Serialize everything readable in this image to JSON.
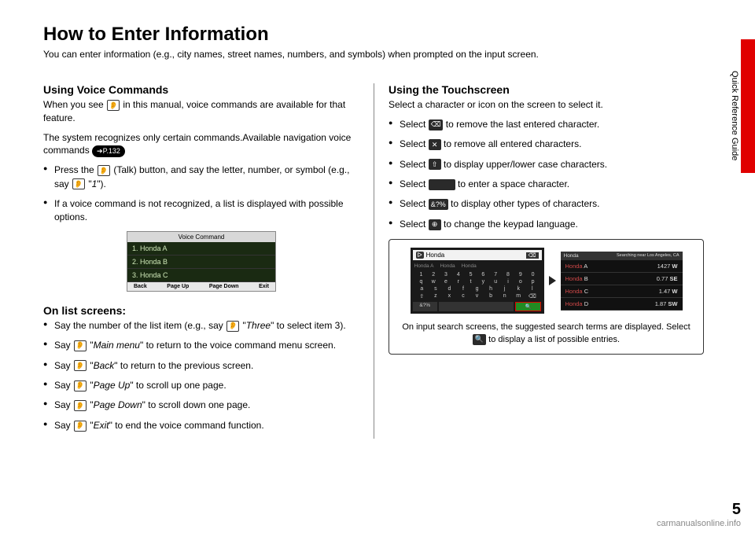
{
  "page": {
    "number": "5",
    "side_label": "Quick Reference Guide",
    "watermark": "carmanualsonline.info"
  },
  "header": {
    "title": "How to Enter Information",
    "intro": "You can enter information (e.g., city names, street names, numbers, and symbols) when prompted on the input screen."
  },
  "voice": {
    "heading": "Using Voice Commands",
    "p1a": "When you see ",
    "p1b": " in this manual, voice commands are available for that feature.",
    "p2": "The system recognizes only certain commands.Available navigation voice commands ",
    "pageref": "P.132",
    "b1a": "Press the ",
    "b1b": " (Talk) button, and say the letter, number, or symbol (e.g., say ",
    "b1c": " \"",
    "b1_cmd": "1",
    "b1d": "\").",
    "b2": "If a voice command is not recognized, a list is displayed with possible options.",
    "screenshot": {
      "title": "Voice Command",
      "rows": [
        "1. Honda A",
        "2. Honda B",
        "3. Honda C"
      ],
      "foot": [
        "Back",
        "Page Up",
        "Page Down",
        "Exit"
      ]
    }
  },
  "list": {
    "heading": "On list screens:",
    "b1a": "Say the number of the list item (e.g., say ",
    "b1b": " \"",
    "b1_cmd": "Three",
    "b1c": "\" to select item 3).",
    "b2a": "Say ",
    "b2_cmd": "Main menu",
    "b2b": "\" to return to the voice command menu screen.",
    "b3a": "Say ",
    "b3_cmd": "Back",
    "b3b": "\" to return to the previous screen.",
    "b4a": "Say ",
    "b4_cmd": "Page Up",
    "b4b": "\" to scroll up one page.",
    "b5a": "Say ",
    "b5_cmd": "Page Down",
    "b5b": "\" to scroll down one page.",
    "b6a": "Say ",
    "b6_cmd": "Exit",
    "b6b": "\" to end the voice command function."
  },
  "touch": {
    "heading": "Using the Touchscreen",
    "p1": "Select a character or icon on the screen to select it.",
    "b1": " to remove the last entered character.",
    "b2": " to remove all entered characters.",
    "b3": " to display upper/lower case characters.",
    "b4": " to enter a space character.",
    "b5": " to display other types of characters.",
    "b6": " to change the keypad language.",
    "select": "Select ",
    "icons": {
      "del": "⌫",
      "clear": "✕",
      "shift": "⇧",
      "sym": "&?%",
      "globe": "⊕"
    },
    "keyboard": {
      "query": "Honda",
      "sugg": [
        "Honda A",
        "Honda",
        "Honda"
      ],
      "r1": [
        "1",
        "2",
        "3",
        "4",
        "5",
        "6",
        "7",
        "8",
        "9",
        "0"
      ],
      "r2": [
        "q",
        "w",
        "e",
        "r",
        "t",
        "y",
        "u",
        "i",
        "o",
        "p"
      ],
      "r3": [
        "a",
        "s",
        "d",
        "f",
        "g",
        "h",
        "j",
        "k",
        "l"
      ],
      "r4": [
        "z",
        "x",
        "c",
        "v",
        "b",
        "n",
        "m"
      ],
      "bot": [
        "⇧",
        "&?%"
      ]
    },
    "results": {
      "head_l": "Honda",
      "head_r": "Searching near Los Angeles, CA",
      "rows": [
        {
          "brand": "Honda",
          "suf": " A",
          "dist": "1427",
          "dir": "W"
        },
        {
          "brand": "Honda",
          "suf": " B",
          "dist": "0.77",
          "dir": "SE"
        },
        {
          "brand": "Honda",
          "suf": " C",
          "dist": "1.47",
          "dir": "W"
        },
        {
          "brand": "Honda",
          "suf": " D",
          "dist": "1.87",
          "dir": "SW"
        }
      ]
    },
    "caption_a": "On input search screens, the suggested search terms are displayed. Select ",
    "caption_b": " to display a list of possible entries."
  }
}
